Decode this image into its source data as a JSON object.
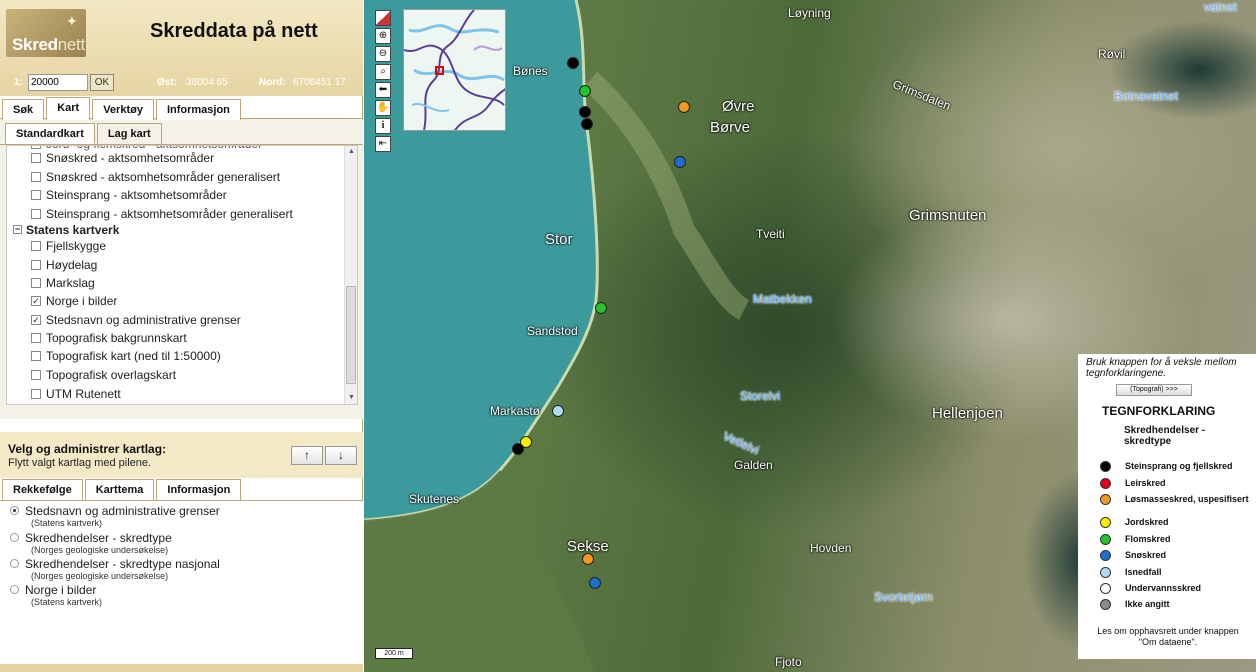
{
  "header": {
    "logo_text_a": "Skred",
    "logo_text_b": "nett",
    "title": "Skreddata på nett",
    "scale_prefix": "1:",
    "scale_value": "20000",
    "ok_label": "OK",
    "east_label": "Øst:",
    "east_value": "38004 65",
    "north_label": "Nord:",
    "north_value": "6708451 17"
  },
  "main_tabs": [
    "Søk",
    "Kart",
    "Verktøy",
    "Informasjon"
  ],
  "sub_tabs": [
    "Standardkart",
    "Lag kart"
  ],
  "layers": [
    {
      "label": "Snøskred - aktsomhetsområder",
      "checked": false,
      "type": "item"
    },
    {
      "label": "Snøskred - aktsomhetsområder generalisert",
      "checked": false,
      "type": "item"
    },
    {
      "label": "Steinsprang - aktsomhetsområder",
      "checked": false,
      "type": "item"
    },
    {
      "label": "Steinsprang - aktsomhetsområder generalisert",
      "checked": false,
      "type": "item"
    },
    {
      "label": "Statens kartverk",
      "checked": false,
      "type": "group"
    },
    {
      "label": "Fjellskygge",
      "checked": false,
      "type": "item"
    },
    {
      "label": "Høydelag",
      "checked": false,
      "type": "item"
    },
    {
      "label": "Markslag",
      "checked": false,
      "type": "item"
    },
    {
      "label": "Norge i bilder",
      "checked": true,
      "type": "item"
    },
    {
      "label": "Stedsnavn og administrative grenser",
      "checked": true,
      "type": "item"
    },
    {
      "label": "Topografisk bakgrunnskart",
      "checked": false,
      "type": "item"
    },
    {
      "label": "Topografisk kart (ned til 1:50000)",
      "checked": false,
      "type": "item"
    },
    {
      "label": "Topografisk overlagskart",
      "checked": false,
      "type": "item"
    },
    {
      "label": "UTM Rutenett",
      "checked": false,
      "type": "item"
    }
  ],
  "manage": {
    "title": "Velg og administrer kartlag:",
    "subtitle": "Flytt valgt kartlag med pilene.",
    "up_label": "↑",
    "down_label": "↓"
  },
  "bottom_tabs": [
    "Rekkefølge",
    "Karttema",
    "Informasjon"
  ],
  "order": [
    {
      "name": "Stedsnavn og administrative grenser",
      "source": "(Statens kartverk)",
      "selected": true
    },
    {
      "name": "Skredhendelser - skredtype",
      "source": "(Norges geologiske undersøkelse)",
      "selected": false
    },
    {
      "name": "Skredhendelser - skredtype nasjonal",
      "source": "(Norges geologiske undersøkelse)",
      "selected": false
    },
    {
      "name": "Norge i bilder",
      "source": "(Statens kartverk)",
      "selected": false
    }
  ],
  "map": {
    "places": [
      "Løyning",
      "Bønes",
      "Øvre",
      "Børve",
      "Grimsdalen",
      "Røvil",
      "Stor",
      "Tveiti",
      "Grimsnuten",
      "Sandstod",
      "Markastø",
      "Skutenes",
      "Hellenjoen",
      "Galden",
      "Sekse",
      "Hovden",
      "Fjoto"
    ],
    "waters": [
      "vatnet",
      "Botnavatnet",
      "Matbekken",
      "Storelvi",
      "Vetlelvi",
      "Svortetjørn"
    ],
    "scale_bar": "200 m"
  },
  "legend": {
    "hint": "Bruk knappen for å veksle mellom tegnforklaringene.",
    "toggle_label": "(Topografi) >>>",
    "title": "TEGNFORKLARING",
    "subtitle": "Skredhendelser - skredtype",
    "items": [
      {
        "label": "Steinsprang og fjellskred",
        "color": "#000000"
      },
      {
        "label": "Leirskred",
        "color": "#e3001b"
      },
      {
        "label": "Løsmasseskred, uspesifisert",
        "color": "#f29a1f"
      },
      {
        "label": "Jordskred",
        "color": "#ffee00"
      },
      {
        "label": "Flomskred",
        "color": "#22c42a"
      },
      {
        "label": "Snøskred",
        "color": "#1c6fd1"
      },
      {
        "label": "Isnedfall",
        "color": "#aedcf5"
      },
      {
        "label": "Undervannsskred",
        "color": "#ffffff"
      },
      {
        "label": "Ikke angitt",
        "color": "#8c8c8c"
      }
    ],
    "footer": "Les om opphavsrett under knappen \"Om dataene\"."
  }
}
